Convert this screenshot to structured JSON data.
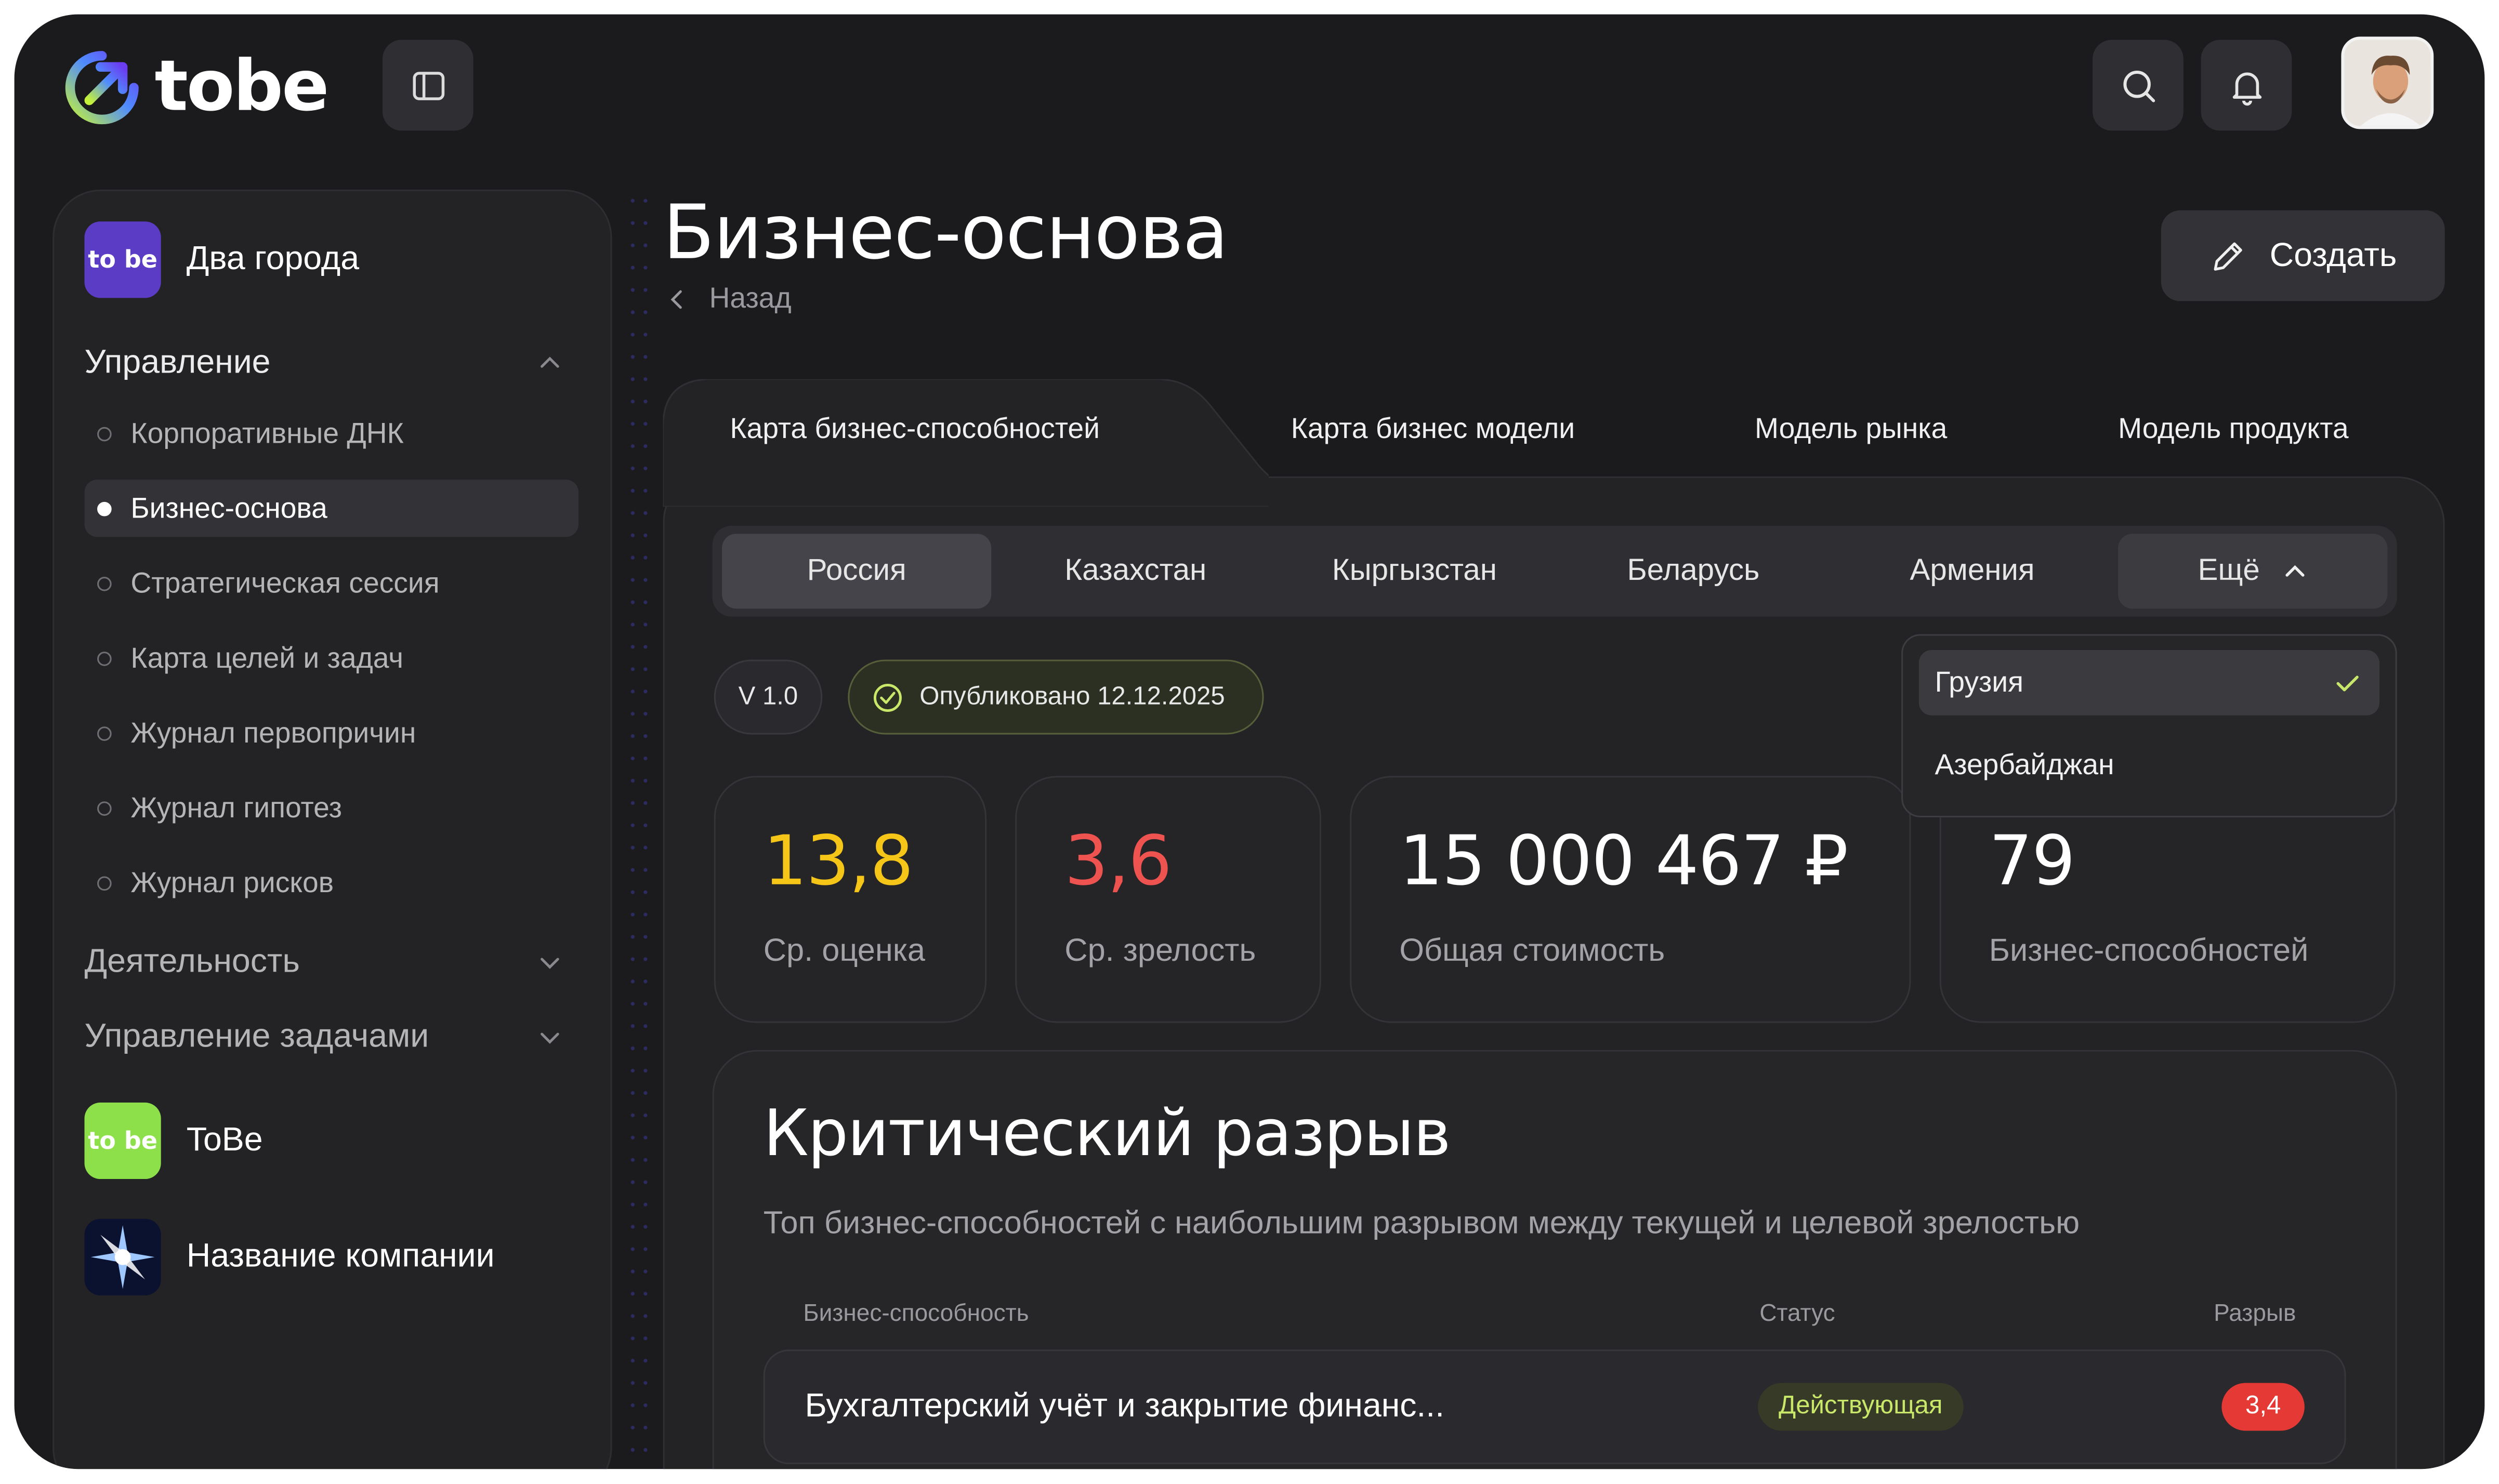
{
  "app": {
    "logo_text": "tobe"
  },
  "sidebar": {
    "workspace": {
      "name": "Два города",
      "logo_text": "to be"
    },
    "groups": [
      {
        "label": "Управление"
      },
      {
        "label": "Деятельность"
      },
      {
        "label": "Управление задачами"
      }
    ],
    "items": [
      {
        "label": "Корпоративные ДНК"
      },
      {
        "label": "Бизнес-основа"
      },
      {
        "label": "Стратегическая сессия"
      },
      {
        "label": "Карта целей и задач"
      },
      {
        "label": "Журнал первопричин"
      },
      {
        "label": "Журнал гипотез"
      },
      {
        "label": "Журнал рисков"
      }
    ],
    "companies": [
      {
        "name": "ToBe",
        "logo_text": "to be"
      },
      {
        "name": "Название компании"
      }
    ]
  },
  "header": {
    "page_title": "Бизнес-основа",
    "back_label": "Назад",
    "create_label": "Создать"
  },
  "tabs": [
    {
      "label": "Карта бизнес-способностей"
    },
    {
      "label": "Карта бизнес модели"
    },
    {
      "label": "Модель рынка"
    },
    {
      "label": "Модель продукта"
    }
  ],
  "countries": [
    {
      "label": "Россия"
    },
    {
      "label": "Казахстан"
    },
    {
      "label": "Кыргызстан"
    },
    {
      "label": "Беларусь"
    },
    {
      "label": "Армения"
    },
    {
      "label": "Ещё"
    }
  ],
  "dropdown": [
    {
      "label": "Грузия"
    },
    {
      "label": "Азербайджан"
    }
  ],
  "version": "V 1.0",
  "published": "Опубликовано 12.12.2025",
  "stats": [
    {
      "value": "13,8",
      "label": "Ср. оценка",
      "color": "#f5c518"
    },
    {
      "value": "3,6",
      "label": "Ср. зрелость",
      "color": "#ef5350"
    },
    {
      "value": "15 000 467 ₽",
      "label": "Общая стоимость",
      "color": "#ffffff"
    },
    {
      "value": "79",
      "label": "Бизнес-способностей",
      "color": "#ffffff"
    }
  ],
  "gap": {
    "title": "Критический разрыв",
    "subtitle": "Топ бизнес-способностей с наибольшим разрывом между текущей и целевой зрелостью",
    "columns": [
      "Бизнес-способность",
      "Статус",
      "Разрыв"
    ],
    "rows": [
      {
        "name": "Бухгалтерский учёт и закрытие финанс...",
        "status": "Действующая",
        "gap": "3,4"
      }
    ]
  },
  "colors": {
    "accent_lime": "#a6e22e",
    "brand_purple": "#5b3cc4",
    "danger": "#e53935"
  }
}
